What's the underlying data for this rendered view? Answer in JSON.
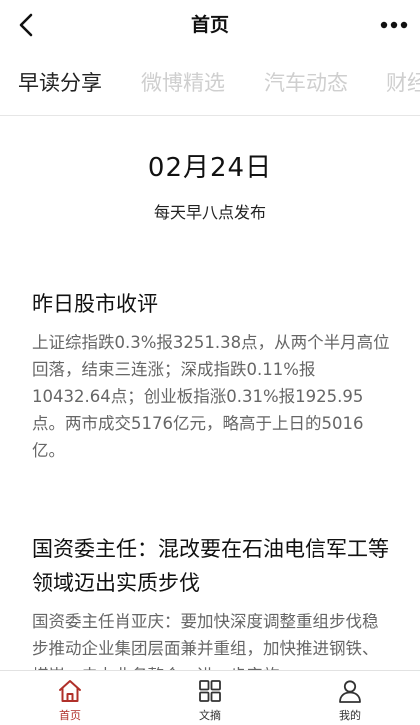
{
  "nav": {
    "title": "首页"
  },
  "tabs": [
    {
      "label": "早读分享",
      "active": true
    },
    {
      "label": "微博精选",
      "active": false
    },
    {
      "label": "汽车动态",
      "active": false
    },
    {
      "label": "财经",
      "active": false
    }
  ],
  "header": {
    "date": "02月24日",
    "subtitle": "每天早八点发布"
  },
  "articles": [
    {
      "title": "昨日股市收评",
      "body": "上证综指跌0.3%报3251.38点，从两个半月高位回落，结束三连涨；深成指跌0.11%报10432.64点；创业板指涨0.31%报1925.95点。两市成交5176亿元，略高于上日的5016亿。"
    },
    {
      "title": "国资委主任：混改要在石油电信军工等领域迈出实质步伐",
      "body": "国资委主任肖亚庆：要加快深度调整重组步伐稳步推动企业集团层面兼并重组，加快推进钢铁、煤炭、电力业务整合，进一步实施"
    }
  ],
  "tabbar": [
    {
      "label": "首页",
      "icon": "home-icon",
      "active": true
    },
    {
      "label": "文摘",
      "icon": "grid-icon",
      "active": false
    },
    {
      "label": "我的",
      "icon": "user-icon",
      "active": false
    }
  ],
  "colors": {
    "accent": "#b0302a",
    "inactive_tab": "#cfcfcf",
    "body_text": "#666666"
  }
}
